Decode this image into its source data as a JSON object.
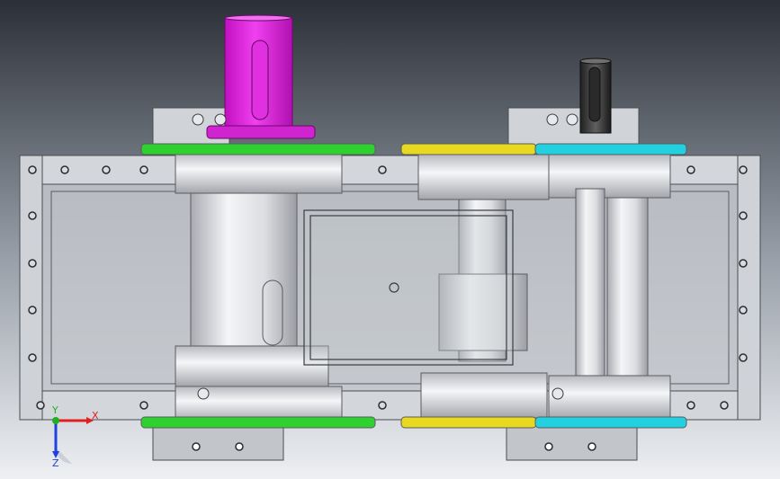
{
  "viewport": {
    "background_top": "#2b3038",
    "background_bottom": "#e6e8ec"
  },
  "colors": {
    "housing": "#c9ccd2",
    "housing_edge": "#4a4d52",
    "shaft_input": "#e020e0",
    "shaft_output": "#3a3a3a",
    "bearing_ring_left": "#2fd12f",
    "bearing_ring_middle": "#e8d820",
    "bearing_ring_right": "#22d0e0",
    "shaft_body": "#e8e9ec",
    "shaft_shadow": "#b8bac0"
  },
  "triad": {
    "x_label": "X",
    "y_label": "Y",
    "z_label": "Z",
    "x_color": "#e02020",
    "y_color": "#20b020",
    "z_color": "#2040e0"
  }
}
